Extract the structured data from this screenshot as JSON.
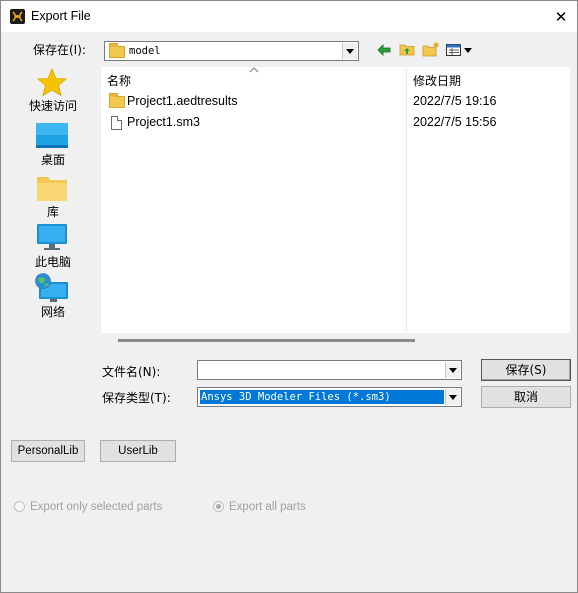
{
  "window": {
    "title": "Export File",
    "close_glyph": "✕"
  },
  "save_in": {
    "label": "保存在(I):",
    "value": "model"
  },
  "toolbar_icons": [
    "back-arrow-icon",
    "up-folder-icon",
    "new-folder-icon",
    "view-menu-icon"
  ],
  "places": [
    {
      "label": "快速访问",
      "icon": "star-icon"
    },
    {
      "label": "桌面",
      "icon": "desktop-icon"
    },
    {
      "label": "库",
      "icon": "library-folder-icon"
    },
    {
      "label": "此电脑",
      "icon": "computer-icon"
    },
    {
      "label": "网络",
      "icon": "network-icon"
    }
  ],
  "file_list": {
    "columns": {
      "name": "名称",
      "date": "修改日期"
    },
    "rows": [
      {
        "name": "Project1.aedtresults",
        "date": "2022/7/5 19:16",
        "type": "folder"
      },
      {
        "name": "Project1.sm3",
        "date": "2022/7/5 15:56",
        "type": "file"
      }
    ]
  },
  "filename": {
    "label": "文件名(N):",
    "value": ""
  },
  "filetype": {
    "label": "保存类型(T):",
    "value": "Ansys 3D Modeler Files (*.sm3)"
  },
  "buttons": {
    "save": "保存(S)",
    "cancel": "取消",
    "personal_lib": "PersonalLib",
    "user_lib": "UserLib"
  },
  "options": {
    "selected_parts": "Export only selected parts",
    "all_parts": "Export all parts"
  },
  "colors": {
    "selection": "#0078d7",
    "folder": "#f3c84f"
  }
}
